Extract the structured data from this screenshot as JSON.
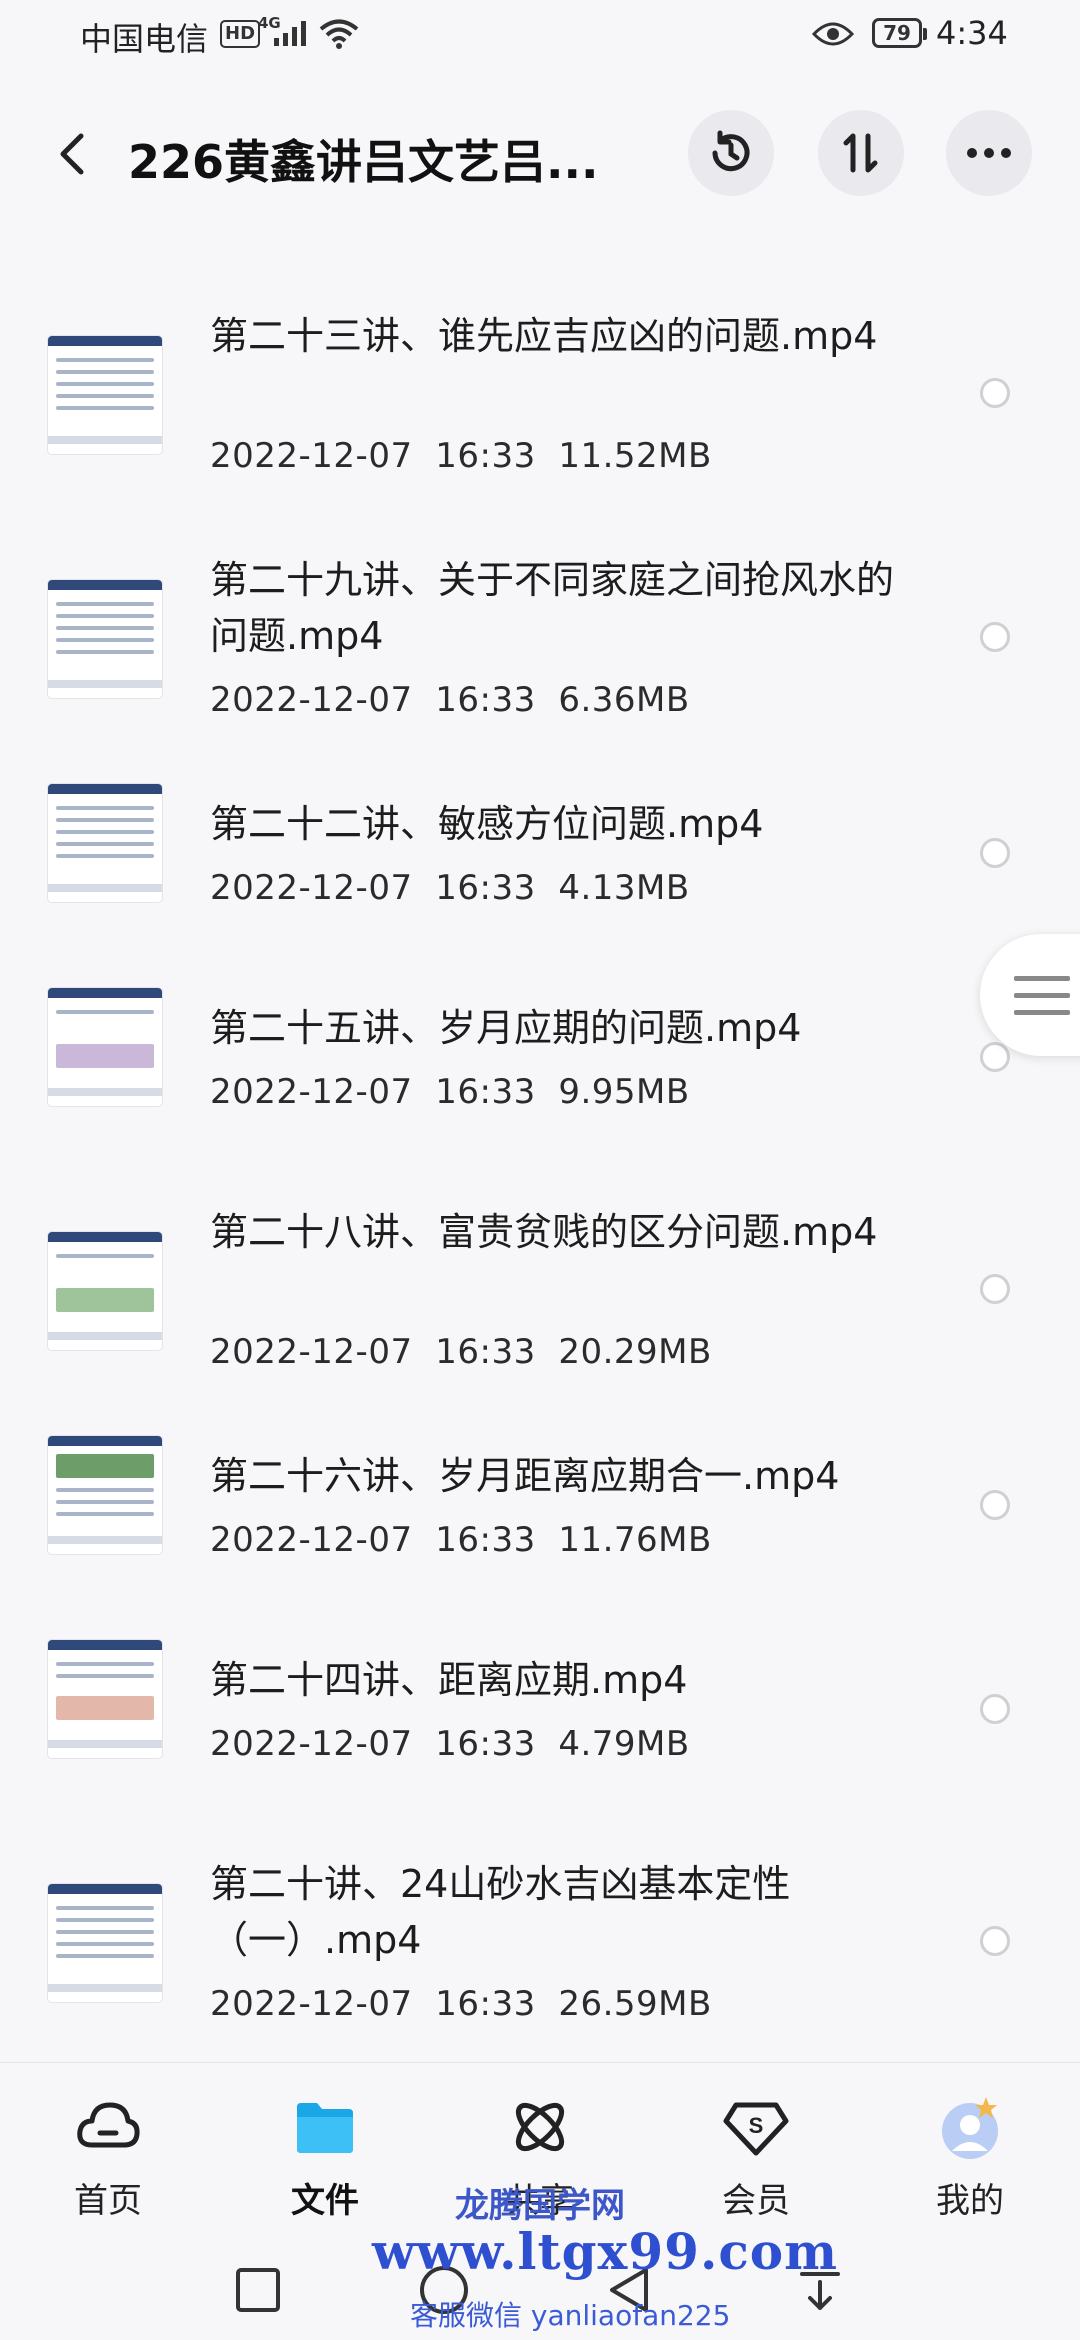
{
  "status_bar": {
    "carrier": "中国电信",
    "hd": "HD",
    "network": "4G",
    "battery": "79",
    "time": "4:34"
  },
  "header": {
    "title": "226黄鑫讲吕文艺吕..."
  },
  "files": [
    {
      "name": "第二十三讲、谁先应吉应凶的问题.mp4",
      "date": "2022-12-07",
      "time": "16:33",
      "size": "11.52MB"
    },
    {
      "name": "第二十九讲、关于不同家庭之间抢风水的问题.mp4",
      "date": "2022-12-07",
      "time": "16:33",
      "size": "6.36MB"
    },
    {
      "name": "第二十二讲、敏感方位问题.mp4",
      "date": "2022-12-07",
      "time": "16:33",
      "size": "4.13MB"
    },
    {
      "name": "第二十五讲、岁月应期的问题.mp4",
      "date": "2022-12-07",
      "time": "16:33",
      "size": "9.95MB"
    },
    {
      "name": "第二十八讲、富贵贫贱的区分问题.mp4",
      "date": "2022-12-07",
      "time": "16:33",
      "size": "20.29MB"
    },
    {
      "name": "第二十六讲、岁月距离应期合一.mp4",
      "date": "2022-12-07",
      "time": "16:33",
      "size": "11.76MB"
    },
    {
      "name": "第二十四讲、距离应期.mp4",
      "date": "2022-12-07",
      "time": "16:33",
      "size": "4.79MB"
    },
    {
      "name": "第二十讲、24山砂水吉凶基本定性（一）.mp4",
      "date": "2022-12-07",
      "time": "16:33",
      "size": "26.59MB"
    }
  ],
  "bottom_nav": {
    "home": "首页",
    "files": "文件",
    "share": "共享",
    "vip": "会员",
    "me": "我的"
  },
  "watermark": {
    "name": "龙腾国学网",
    "url": "www.ltgx99.com",
    "contact": "客服微信 yanliaofan225"
  },
  "colors": {
    "accent": "#1aa7e8",
    "background": "#f7f7f9"
  }
}
